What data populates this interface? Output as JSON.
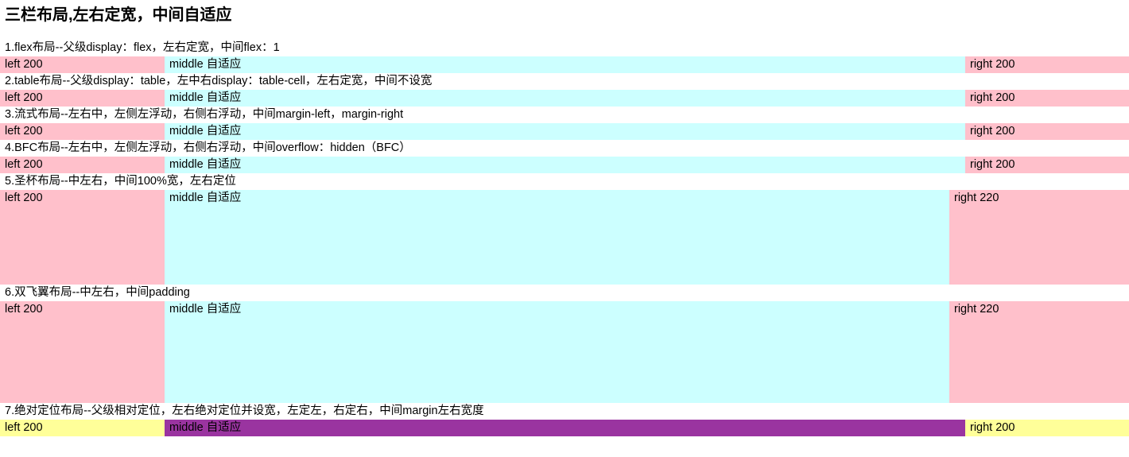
{
  "page": {
    "title": "三栏布局,左右定宽，中间自适应"
  },
  "colors": {
    "pink": "#ffc0cb",
    "cyan": "#ccffff",
    "yellow": "#ffff99",
    "purple": "#9a34a0"
  },
  "layouts": [
    {
      "desc": "1.flex布局--父级display：flex，左右定宽，中间flex：1",
      "left": "left 200",
      "middle": "middle 自适应",
      "right": "right 200"
    },
    {
      "desc": "2.table布局--父级display：table，左中右display：table-cell，左右定宽，中间不设宽",
      "left": "left 200",
      "middle": "middle 自适应",
      "right": "right 200"
    },
    {
      "desc": "3.流式布局--左右中，左侧左浮动，右侧右浮动，中间margin-left，margin-right",
      "left": "left 200",
      "middle": "middle 自适应",
      "right": "right 200"
    },
    {
      "desc": "4.BFC布局--左右中，左侧左浮动，右侧右浮动，中间overflow：hidden（BFC）",
      "left": "left 200",
      "middle": "middle 自适应",
      "right": "right 200"
    },
    {
      "desc": "5.圣杯布局--中左右，中间100%宽，左右定位",
      "left": "left 200",
      "middle": "middle 自适应",
      "right": "right 220"
    },
    {
      "desc": "6.双飞翼布局--中左右，中间padding",
      "left": "left 200",
      "middle": "middle 自适应",
      "right": "right 220"
    },
    {
      "desc": "7.绝对定位布局--父级相对定位，左右绝对定位并设宽，左定左，右定右，中间margin左右宽度",
      "left": "left 200",
      "middle": "middle 自适应",
      "right": "right 200"
    }
  ]
}
